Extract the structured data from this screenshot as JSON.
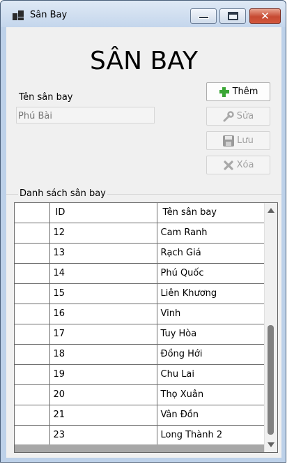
{
  "window": {
    "title": "Sân Bay"
  },
  "form": {
    "heading": "SÂN BAY",
    "name_label": "Tên sân bay",
    "name_value": "Phú Bài",
    "buttons": {
      "add": "Thêm",
      "edit": "Sửa",
      "save": "Lưu",
      "delete": "Xóa"
    }
  },
  "list": {
    "group_title": "Danh sách sân bay",
    "columns": [
      "ID",
      "Tên sân bay"
    ],
    "rows": [
      {
        "id": "12",
        "name": "Cam Ranh"
      },
      {
        "id": "13",
        "name": "Rạch Giá"
      },
      {
        "id": "14",
        "name": "Phú Quốc"
      },
      {
        "id": "15",
        "name": "Liên Khương"
      },
      {
        "id": "16",
        "name": "Vinh"
      },
      {
        "id": "17",
        "name": "Tuy Hòa"
      },
      {
        "id": "18",
        "name": "Đồng Hới"
      },
      {
        "id": "19",
        "name": "Chu Lai"
      },
      {
        "id": "20",
        "name": "Thọ Xuân"
      },
      {
        "id": "21",
        "name": "Vân Đồn"
      },
      {
        "id": "23",
        "name": "Long Thành 2"
      }
    ]
  },
  "icons": {
    "app": "window-app-icon",
    "minimize": "minimize-icon",
    "maximize": "maximize-icon",
    "close": "close-icon",
    "add": "plus-icon",
    "edit": "wrench-icon",
    "save": "floppy-disk-icon",
    "delete": "x-icon"
  },
  "colors": {
    "close_button": "#c64a32",
    "add_icon": "#3aa635",
    "disabled_text": "#a0a0a0"
  }
}
